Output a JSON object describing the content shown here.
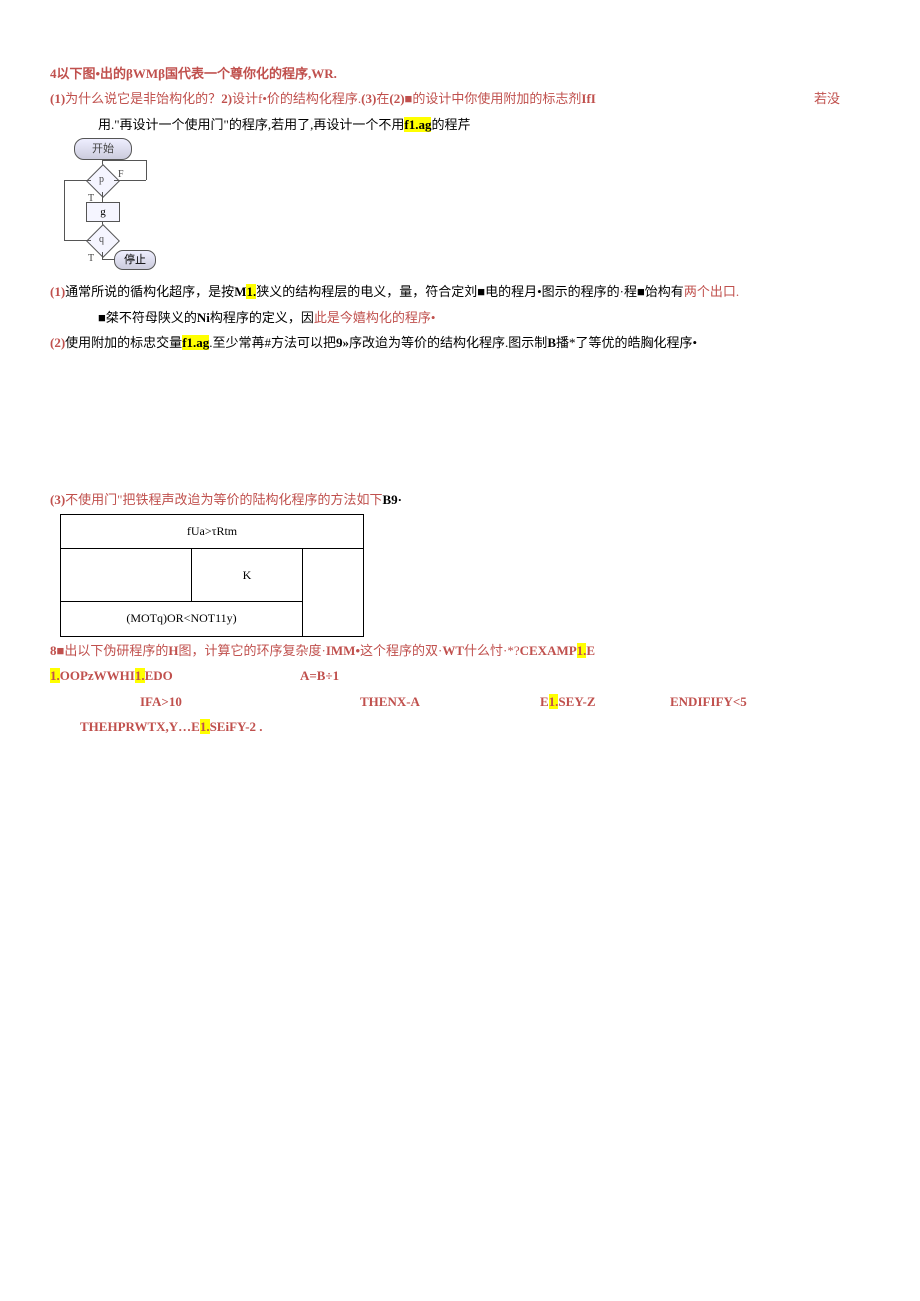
{
  "title": "4以下图•出的βWMβ国代表一个尊你化的程序,WR.",
  "q_line": {
    "part1": "(1)",
    "part1_text": "为什么说它是非饴构化的？",
    "part2": "2)",
    "part2_text": "设计f•价的结构化程序.",
    "part3": "(3)",
    "part3_text": "在",
    "part3b": "(2)■",
    "part3c": "的设计中你使用附加的标志剂",
    "part3d": "IfI",
    "right": "若没"
  },
  "q_line2_a": "用.\"再设计一个使用门\"的程序,若用了,再设计一个不用",
  "q_line2_b": "f1.ag",
  "q_line2_c": "的程芹",
  "flow": {
    "start": "开始",
    "p": "p",
    "g": "g",
    "q": "q",
    "end": "停止",
    "t1": "T",
    "f1": "F",
    "t2": "T"
  },
  "ans1_a": "(1)",
  "ans1_b": "通常所说的循构化超序，是按",
  "ans1_c": "M1.",
  "ans1_d": "狭义的结构程层的电义，量，符合定刘■电的程月•图示的程序的·程■饴构有",
  "ans1_e": "两个出口.",
  "ans1_line2_a": "■桀不符母陕义的",
  "ans1_line2_b": "Ni",
  "ans1_line2_c": "构程序的定义，因",
  "ans1_line2_d": "此是",
  "ans1_line2_e": "今嬉构化的程序•",
  "ans2_a": "(2)",
  "ans2_b": "使用附加的标忠交量",
  "ans2_c": "f1.ag",
  "ans2_d": ".至少常苒#方法可以把",
  "ans2_e": "9»",
  "ans2_f": "序改迨为等价的结构化程序.图示制",
  "ans2_g": "B",
  "ans2_h": "播*了等优的皓胸化程序•",
  "ans3_a": "(3)",
  "ans3_b": "不使用门\"把铁程声改迨为等价的陆构化程序的方法如下",
  "ans3_c": "B9·",
  "table": {
    "r1": "fUa>τRtm",
    "r2": "K",
    "r3": "(MOTq)OR<NOT11y)"
  },
  "q8_a": "8■",
  "q8_b": "出以下伪研程序的",
  "q8_c": "H",
  "q8_d": "图，计算它的环序复杂度·",
  "q8_e": "IMM•",
  "q8_f": "这个程序的双·",
  "q8_g": "WT",
  "q8_h": "什么忖·*?",
  "q8_i": "CEXAMP1.E",
  "code1_a": "1.OOPzWWHI1.EDO",
  "code1_b": "A=B÷1",
  "code2_a": "IFA>10",
  "code2_b": "THENX-A",
  "code2_c": "E1.SEY-Z",
  "code2_d": "ENDIFIFY<5",
  "code3": "THEHPRWTX,Y…E1.SEiFY-2 ."
}
